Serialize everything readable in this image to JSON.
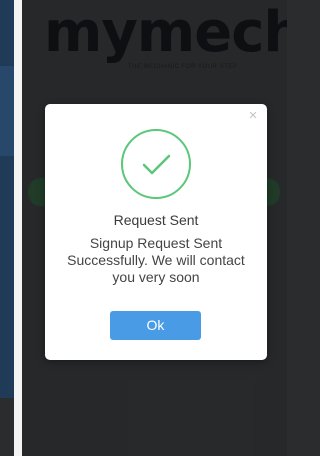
{
  "brand": {
    "logo_text_my": "my",
    "logo_text_mech": "mech",
    "tagline": "THE MECHANIC FOR YOUR STEP"
  },
  "dialog": {
    "close_glyph": "×",
    "title": "Request Sent",
    "message": "Signup Request Sent Successfully. We will contact you very soon",
    "ok_label": "Ok",
    "icon": "success-check-icon"
  },
  "colors": {
    "accent": "#4a9be6",
    "success": "#5cc77a",
    "background": "#2b2c2e"
  }
}
